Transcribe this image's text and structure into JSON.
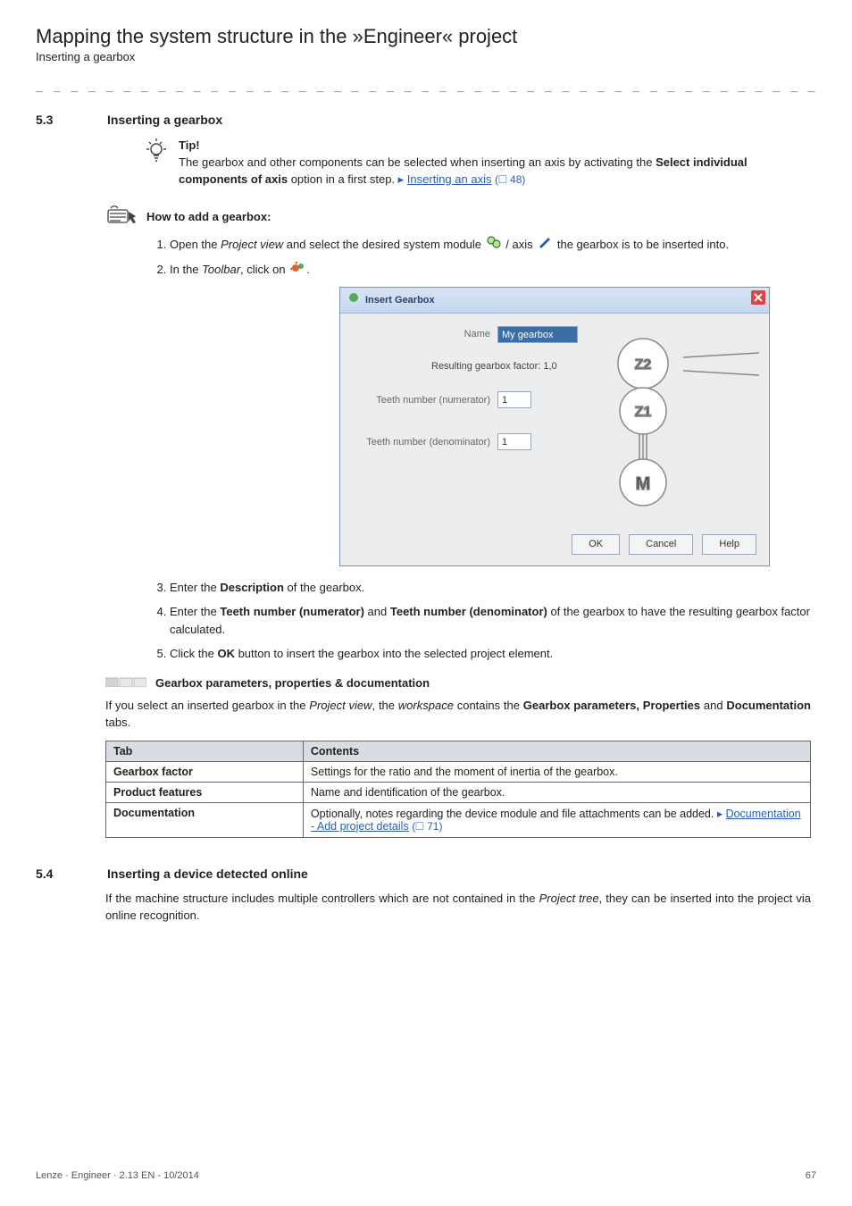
{
  "chapter_title": "Mapping the system structure in the »Engineer« project",
  "sub_title": "Inserting a gearbox",
  "dashline": "_ _ _ _ _ _ _ _ _ _ _ _ _ _ _ _ _ _ _ _ _ _ _ _ _ _ _ _ _ _ _ _ _ _ _ _ _ _ _ _ _ _ _ _ _ _ _ _ _ _ _ _ _ _ _ _ _ _ _ _ _ _ _ _",
  "s53": {
    "num": "5.3",
    "heading": "Inserting a gearbox",
    "tip_label": "Tip!",
    "tip_text_a": "The gearbox and other components can be selected when inserting an axis by activating the ",
    "tip_bold": "Select individual components of axis",
    "tip_text_b": " option in a first step.  ",
    "tip_link": "Inserting an axis",
    "tip_pageref": "(🞎 48)",
    "howto_label": "How to add a gearbox:",
    "step1_a": "Open the ",
    "step1_i": "Project view",
    "step1_b": " and select the desired system module ",
    "step1_c": " / axis ",
    "step1_d": " the gearbox is to be inserted into.",
    "step2_a": "In the ",
    "step2_i": "Toolbar",
    "step2_b": ", click on ",
    "step2_c": ".",
    "step3_a": "Enter the ",
    "step3_bold": "Description",
    "step3_b": " of the gearbox.",
    "step4_a": "Enter the ",
    "step4_bold1": "Teeth number (numerator)",
    "step4_mid": " and ",
    "step4_bold2": "Teeth number (denominator)",
    "step4_b": " of the gearbox to have the resulting gearbox factor calculated.",
    "step5_a": "Click the ",
    "step5_bold": "OK",
    "step5_b": " button to insert the gearbox into the selected project element."
  },
  "dialog": {
    "title": "Insert Gearbox",
    "name_label": "Name",
    "name_value": "My gearbox",
    "result_label": "Resulting gearbox factor: 1,0",
    "num_label": "Teeth number (numerator)",
    "num_value": "1",
    "den_label": "Teeth number (denominator)",
    "den_value": "1",
    "z2": "Z2",
    "z1": "Z1",
    "m": "M",
    "btn_ok": "OK",
    "btn_cancel": "Cancel",
    "btn_help": "Help"
  },
  "para": {
    "title": "Gearbox parameters, properties & documentation",
    "text_a": "If you select an inserted gearbox in the ",
    "text_i1": "Project view",
    "text_b": ", the ",
    "text_i2": "workspace",
    "text_c": " contains the ",
    "text_bold": "Gearbox parameters, Properties",
    "text_d": " and ",
    "text_bold2": "Documentation",
    "text_e": " tabs."
  },
  "table": {
    "h1": "Tab",
    "h2": "Contents",
    "r1c1": "Gearbox factor",
    "r1c2": "Settings for the ratio and the moment of inertia of the gearbox.",
    "r2c1": "Product features",
    "r2c2": "Name and identification of the gearbox.",
    "r3c1": "Documentation",
    "r3c2a": "Optionally, notes regarding the device module and file attachments can be added.  ",
    "r3link": "Documentation - Add project details",
    "r3pageref": "(🞎 71)"
  },
  "s54": {
    "num": "5.4",
    "heading": "Inserting a device detected online",
    "text_a": "If the machine structure includes multiple controllers which are not contained in the ",
    "text_i": "Project tree",
    "text_b": ", they can be inserted into the project via online recognition."
  },
  "footer": {
    "left": "Lenze · Engineer · 2.13 EN - 10/2014",
    "right": "67"
  }
}
